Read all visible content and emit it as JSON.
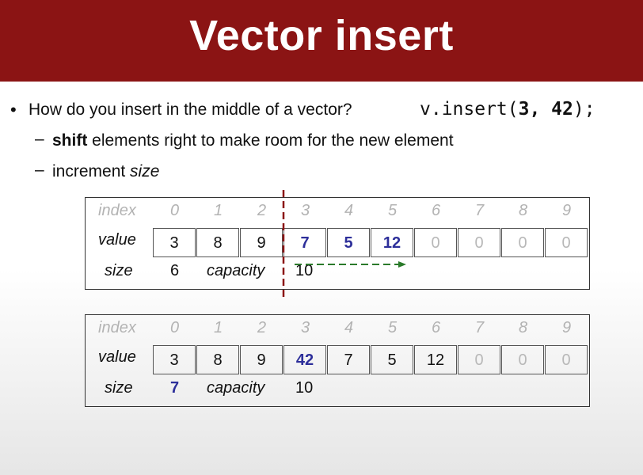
{
  "slide": {
    "title": "Vector insert"
  },
  "bullets": {
    "main": "How do you insert in the middle of a vector?",
    "code_pre": "v.insert(",
    "code_args": "3, 42",
    "code_post": ");",
    "sub1_bold": "shift",
    "sub1_rest": " elements right to make room for the new element",
    "sub2_pre": "increment ",
    "sub2_em": "size"
  },
  "labels": {
    "index": "index",
    "value": "value",
    "size": "size",
    "capacity": "capacity"
  },
  "indices": [
    "0",
    "1",
    "2",
    "3",
    "4",
    "5",
    "6",
    "7",
    "8",
    "9"
  ],
  "before": {
    "values": [
      "3",
      "8",
      "9",
      "7",
      "5",
      "12",
      "0",
      "0",
      "0",
      "0"
    ],
    "size": "6",
    "capacity": "10"
  },
  "after": {
    "values": [
      "3",
      "8",
      "9",
      "42",
      "7",
      "5",
      "12",
      "0",
      "0",
      "0"
    ],
    "size": "7",
    "capacity": "10"
  },
  "colors": {
    "title_bar": "#8b1414",
    "highlight": "#2d2f9a",
    "divider": "#8b1414",
    "arrow": "#2a7a2a",
    "unused": "#b8b8b8"
  }
}
